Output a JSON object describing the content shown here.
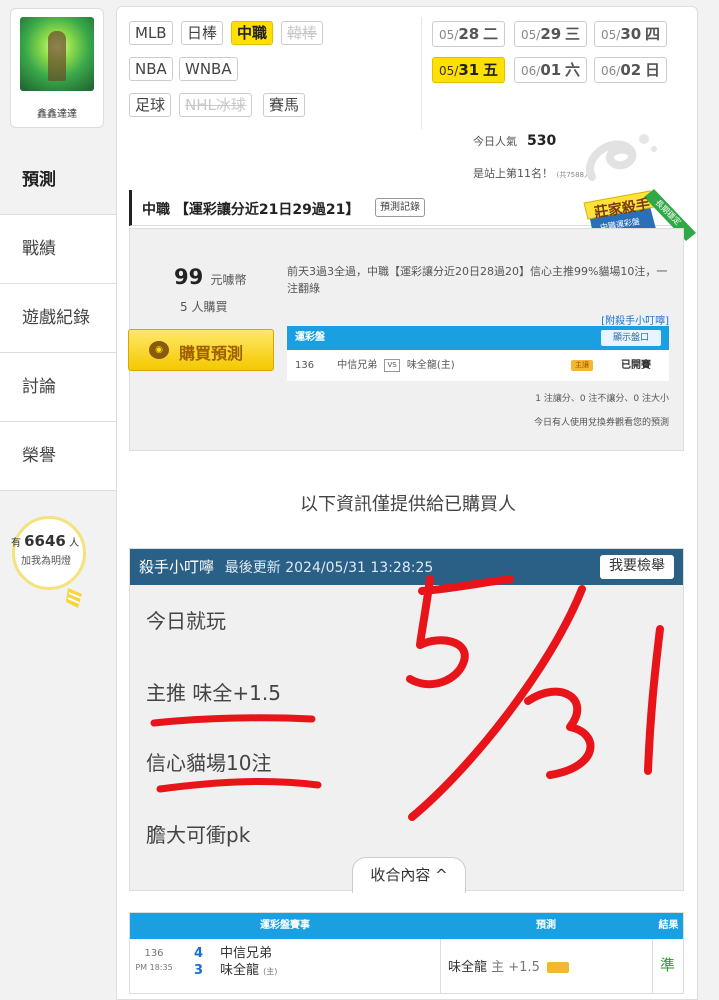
{
  "user": {
    "name": "鑫鑫達達"
  },
  "nav": [
    {
      "label": "預測"
    },
    {
      "label": "戰績"
    },
    {
      "label": "遊戲紀錄"
    },
    {
      "label": "討論"
    },
    {
      "label": "榮譽"
    }
  ],
  "fans": {
    "prefix": "有",
    "count": "6646",
    "suffix": "人",
    "subtitle": "加我為明燈"
  },
  "leagues": [
    {
      "label": "MLB"
    },
    {
      "label": "日棒"
    },
    {
      "label": "中職"
    },
    {
      "label": "韓棒"
    },
    {
      "label": "NBA"
    },
    {
      "label": "WNBA"
    },
    {
      "label": "足球"
    },
    {
      "label": "NHL冰球"
    },
    {
      "label": "賽馬"
    }
  ],
  "dates": [
    {
      "md": "05/",
      "d": "28",
      "wd": "二"
    },
    {
      "md": "05/",
      "d": "29",
      "wd": "三"
    },
    {
      "md": "05/",
      "d": "30",
      "wd": "四"
    },
    {
      "md": "05/",
      "d": "31",
      "wd": "五"
    },
    {
      "md": "06/",
      "d": "01",
      "wd": "六"
    },
    {
      "md": "06/",
      "d": "02",
      "wd": "日"
    }
  ],
  "popularity": {
    "label": "今日人氣",
    "value": "530",
    "rank_text": "是站上第11名！",
    "rank_note": "(共7588人)"
  },
  "pick": {
    "title": "中職 【運彩讓分近21日29過21】",
    "record_button": "預測記錄",
    "badge_title": "莊家殺手",
    "badge_sub": "中職運彩盤",
    "badge_ribbon": "長期穩定"
  },
  "purchase": {
    "price": "99",
    "unit": "元噱幣",
    "buyers": "5 人購買",
    "button": "購買預測",
    "summary": "前天3過3全過，中職【運彩讓分近20日28過20】信心主推99%貓場10注，一注翻綠",
    "attach_link": "[附殺手小叮嚀]",
    "table_title": "運彩盤",
    "show_button": "顯示盤口",
    "row": {
      "no": "136",
      "away": "中信兄弟",
      "vs": "VS",
      "home": "味全龍(主)",
      "status": "已開賽"
    },
    "stats": "1 注讓分、0 注不讓分、0 注大小",
    "exchange": "今日有人使用兌換券觀看您的預測"
  },
  "notice": "以下資訊僅提供給已購買人",
  "tips": {
    "title": "殺手小叮嚀",
    "updated": "最後更新 2024/05/31 13:28:25",
    "report_button": "我要檢舉",
    "lines": [
      "今日就玩",
      "主推 味全+1.5",
      "信心貓場10注",
      "膽大可衝pk"
    ],
    "collapse_button": "收合內容 ^",
    "ink_color": "#e8141a"
  },
  "results": {
    "headers": [
      "運彩盤賽事",
      "預測",
      "結果"
    ],
    "game_no": "136",
    "time": "PM 18:35",
    "away_score": "4",
    "home_score": "3",
    "away": "中信兄弟",
    "home": "味全龍",
    "home_mark": "(主)",
    "prediction_team": "味全龍",
    "prediction_line": "主 +1.5",
    "result": "準"
  },
  "colors": {
    "highlight": "#ffe000",
    "header_blue": "#1aa0e0",
    "tip_header": "#2a5f86"
  }
}
